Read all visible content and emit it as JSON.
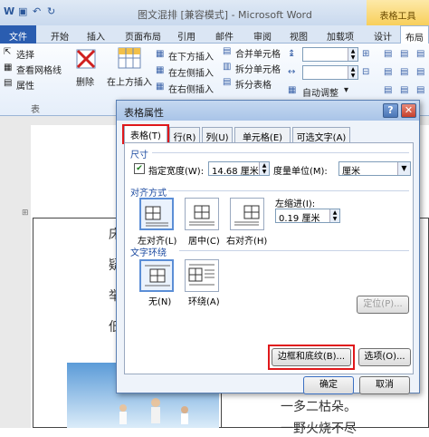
{
  "window": {
    "title": "图文混排 [兼容模式] - Microsoft Word",
    "context_group": "表格工具",
    "qa_icons": [
      "word-icon",
      "save-icon",
      "undo-icon",
      "redo-icon"
    ]
  },
  "ribbon_tabs": [
    "文件",
    "开始",
    "插入",
    "页面布局",
    "引用",
    "邮件",
    "审阅",
    "视图",
    "加载项",
    "设计",
    "布局"
  ],
  "ribbon": {
    "select": "选择",
    "gridlines": "查看网格线",
    "properties": "属性",
    "group_table": "表",
    "delete": "删除",
    "insert_above": "在上方插入",
    "insert_below": "在下方插入",
    "insert_left": "在左侧插入",
    "insert_right": "在右侧插入",
    "merge": "合并单元格",
    "split_cells": "拆分单元格",
    "split_table": "拆分表格",
    "autofit": "自动调整"
  },
  "document": {
    "lines": [
      "床",
      "疑",
      "举",
      "低"
    ],
    "bottom_line1": "一多二枯朵。",
    "bottom_line2": "一野火烧不尽"
  },
  "dialog": {
    "title": "表格属性",
    "help": "?",
    "close": "✕",
    "tabs": [
      "表格(T)",
      "行(R)",
      "列(U)",
      "单元格(E)",
      "可选文字(A)"
    ],
    "size_section": "尺寸",
    "specify_width_label": "指定宽度(W):",
    "width_value": "14.68 厘米",
    "measure_label": "度量单位(M):",
    "measure_value": "厘米",
    "align_section": "对齐方式",
    "indent_label": "左缩进(I):",
    "indent_value": "0.19 厘米",
    "align_options": [
      "左对齐(L)",
      "居中(C)",
      "右对齐(H)"
    ],
    "wrap_section": "文字环绕",
    "wrap_options": [
      "无(N)",
      "环绕(A)"
    ],
    "position_button": "定位(P)...",
    "borders_button": "边框和底纹(B)...",
    "options_button": "选项(O)...",
    "ok": "确定",
    "cancel": "取消"
  }
}
